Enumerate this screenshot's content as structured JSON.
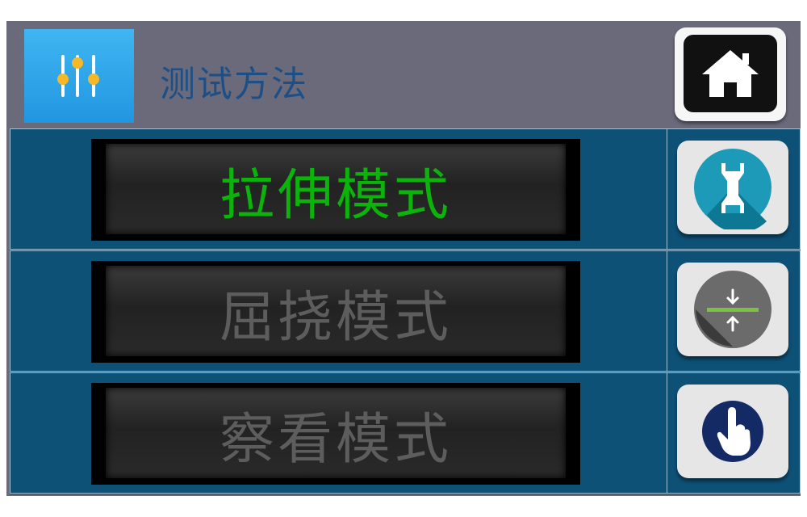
{
  "header": {
    "title": "测试方法"
  },
  "modes": [
    {
      "label": "拉伸模式",
      "color": "#0bb30b",
      "icon": "tensile-specimen-icon"
    },
    {
      "label": "屈挠模式",
      "color": "#5d5d5d",
      "icon": "flex-compress-icon"
    },
    {
      "label": "察看模式",
      "color": "#5d5d5d",
      "icon": "touch-hand-icon"
    }
  ],
  "colors": {
    "panel": "#6b6a7b",
    "grid": "#0e5177",
    "title": "#1d4f86",
    "active": "#0bb30b",
    "inactive": "#5d5d5d"
  }
}
